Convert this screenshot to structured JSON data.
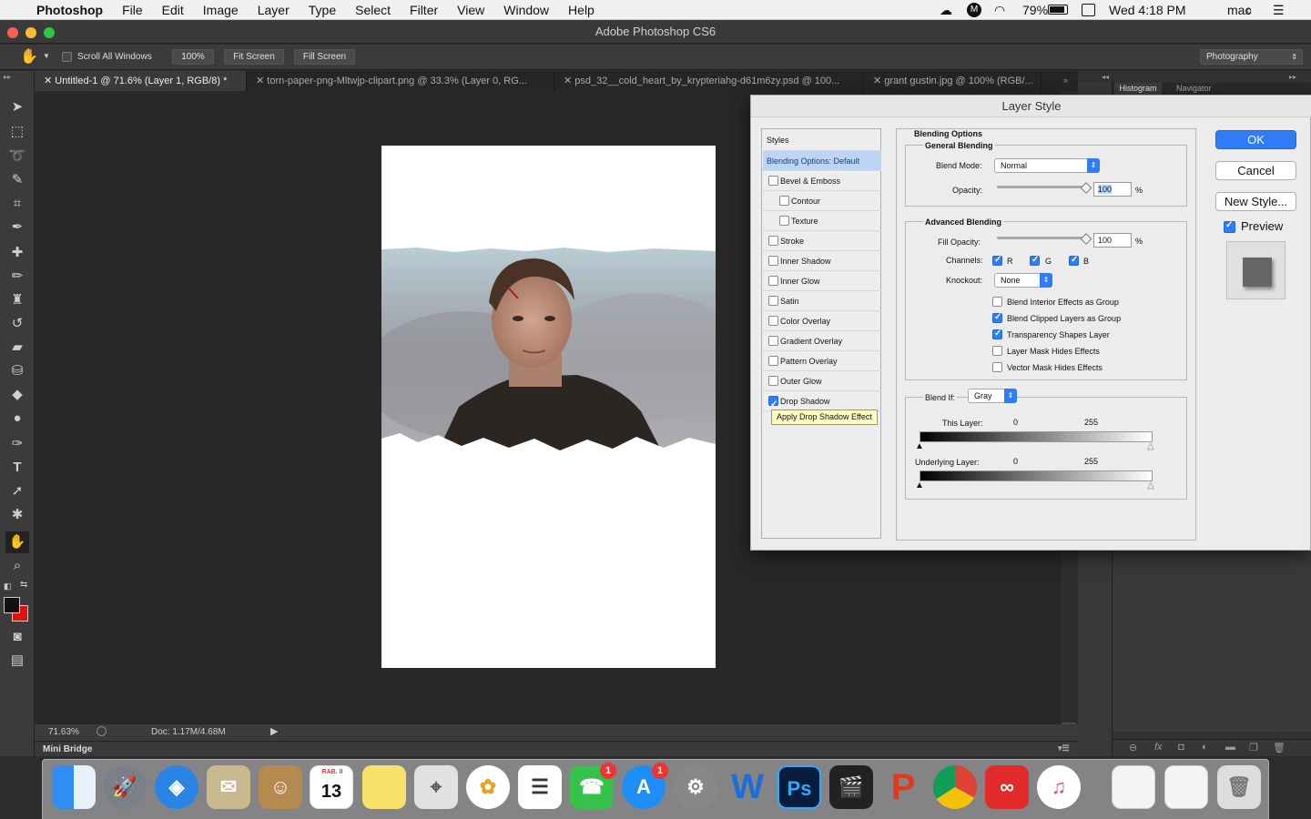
{
  "menubar": {
    "apple": "",
    "app": "Photoshop",
    "items": [
      "File",
      "Edit",
      "Image",
      "Layer",
      "Type",
      "Select",
      "Filter",
      "View",
      "Window",
      "Help"
    ],
    "battery": "79%",
    "clock": "Wed 4:18 PM",
    "user": "mac"
  },
  "window": {
    "title": "Adobe Photoshop CS6"
  },
  "options": {
    "scroll_all": "Scroll All Windows",
    "zoom100": "100%",
    "fit_screen": "Fit Screen",
    "fill_screen": "Fill Screen",
    "workspace": "Photography"
  },
  "tabs": [
    {
      "label": "Untitled-1 @ 71.6% (Layer 1, RGB/8) *"
    },
    {
      "label": "torn-paper-png-Mltwjp-clipart.png @ 33.3% (Layer 0, RG..."
    },
    {
      "label": "psd_32__cold_heart_by_krypteriahg-d61m6zy.psd @ 100..."
    },
    {
      "label": "grant gustin.jpg @ 100% (RGB/..."
    }
  ],
  "panel_tabs": {
    "histogram": "Histogram",
    "navigator": "Navigator"
  },
  "status": {
    "zoom": "71.63%",
    "doc": "Doc: 1.17M/4.68M"
  },
  "minibridge": "Mini Bridge",
  "dialog": {
    "title": "Layer Style",
    "styles_header": "Styles",
    "styles": [
      {
        "label": "Blending Options: Default",
        "checkbox": false,
        "checked": false,
        "indent": false,
        "selected": true
      },
      {
        "label": "Bevel & Emboss",
        "checkbox": true,
        "checked": false,
        "indent": false
      },
      {
        "label": "Contour",
        "checkbox": true,
        "checked": false,
        "indent": true
      },
      {
        "label": "Texture",
        "checkbox": true,
        "checked": false,
        "indent": true
      },
      {
        "label": "Stroke",
        "checkbox": true,
        "checked": false,
        "indent": false
      },
      {
        "label": "Inner Shadow",
        "checkbox": true,
        "checked": false,
        "indent": false
      },
      {
        "label": "Inner Glow",
        "checkbox": true,
        "checked": false,
        "indent": false
      },
      {
        "label": "Satin",
        "checkbox": true,
        "checked": false,
        "indent": false
      },
      {
        "label": "Color Overlay",
        "checkbox": true,
        "checked": false,
        "indent": false
      },
      {
        "label": "Gradient Overlay",
        "checkbox": true,
        "checked": false,
        "indent": false
      },
      {
        "label": "Pattern Overlay",
        "checkbox": true,
        "checked": false,
        "indent": false
      },
      {
        "label": "Outer Glow",
        "checkbox": true,
        "checked": false,
        "indent": false
      },
      {
        "label": "Drop Shadow",
        "checkbox": true,
        "checked": true,
        "indent": false
      }
    ],
    "tooltip": "Apply Drop Shadow Effect",
    "blending_options": "Blending Options",
    "general_blending": "General Blending",
    "blend_mode_label": "Blend Mode:",
    "blend_mode": "Normal",
    "opacity_label": "Opacity:",
    "opacity": "100",
    "opacity_pct": 100,
    "percent": "%",
    "advanced_blending": "Advanced Blending",
    "fill_opacity_label": "Fill Opacity:",
    "fill_opacity": "100",
    "fill_opacity_pct": 100,
    "channels_label": "Channels:",
    "channel_r": "R",
    "channel_g": "G",
    "channel_b": "B",
    "knockout_label": "Knockout:",
    "knockout": "None",
    "adv_options": [
      {
        "label": "Blend Interior Effects as Group",
        "checked": false
      },
      {
        "label": "Blend Clipped Layers as Group",
        "checked": true
      },
      {
        "label": "Transparency Shapes Layer",
        "checked": true
      },
      {
        "label": "Layer Mask Hides Effects",
        "checked": false
      },
      {
        "label": "Vector Mask Hides Effects",
        "checked": false
      }
    ],
    "blend_if_label": "Blend If:",
    "blend_if": "Gray",
    "this_layer_label": "This Layer:",
    "underlying_label": "Underlying Layer:",
    "range_min": "0",
    "range_max": "255",
    "ok": "OK",
    "cancel": "Cancel",
    "new_style": "New Style...",
    "preview": "Preview"
  },
  "dock": {
    "calendar_month": "RAB. II",
    "calendar_day": "13",
    "facetime_badge": "1",
    "appstore_badge": "1",
    "ps": "Ps",
    "word": "W"
  }
}
